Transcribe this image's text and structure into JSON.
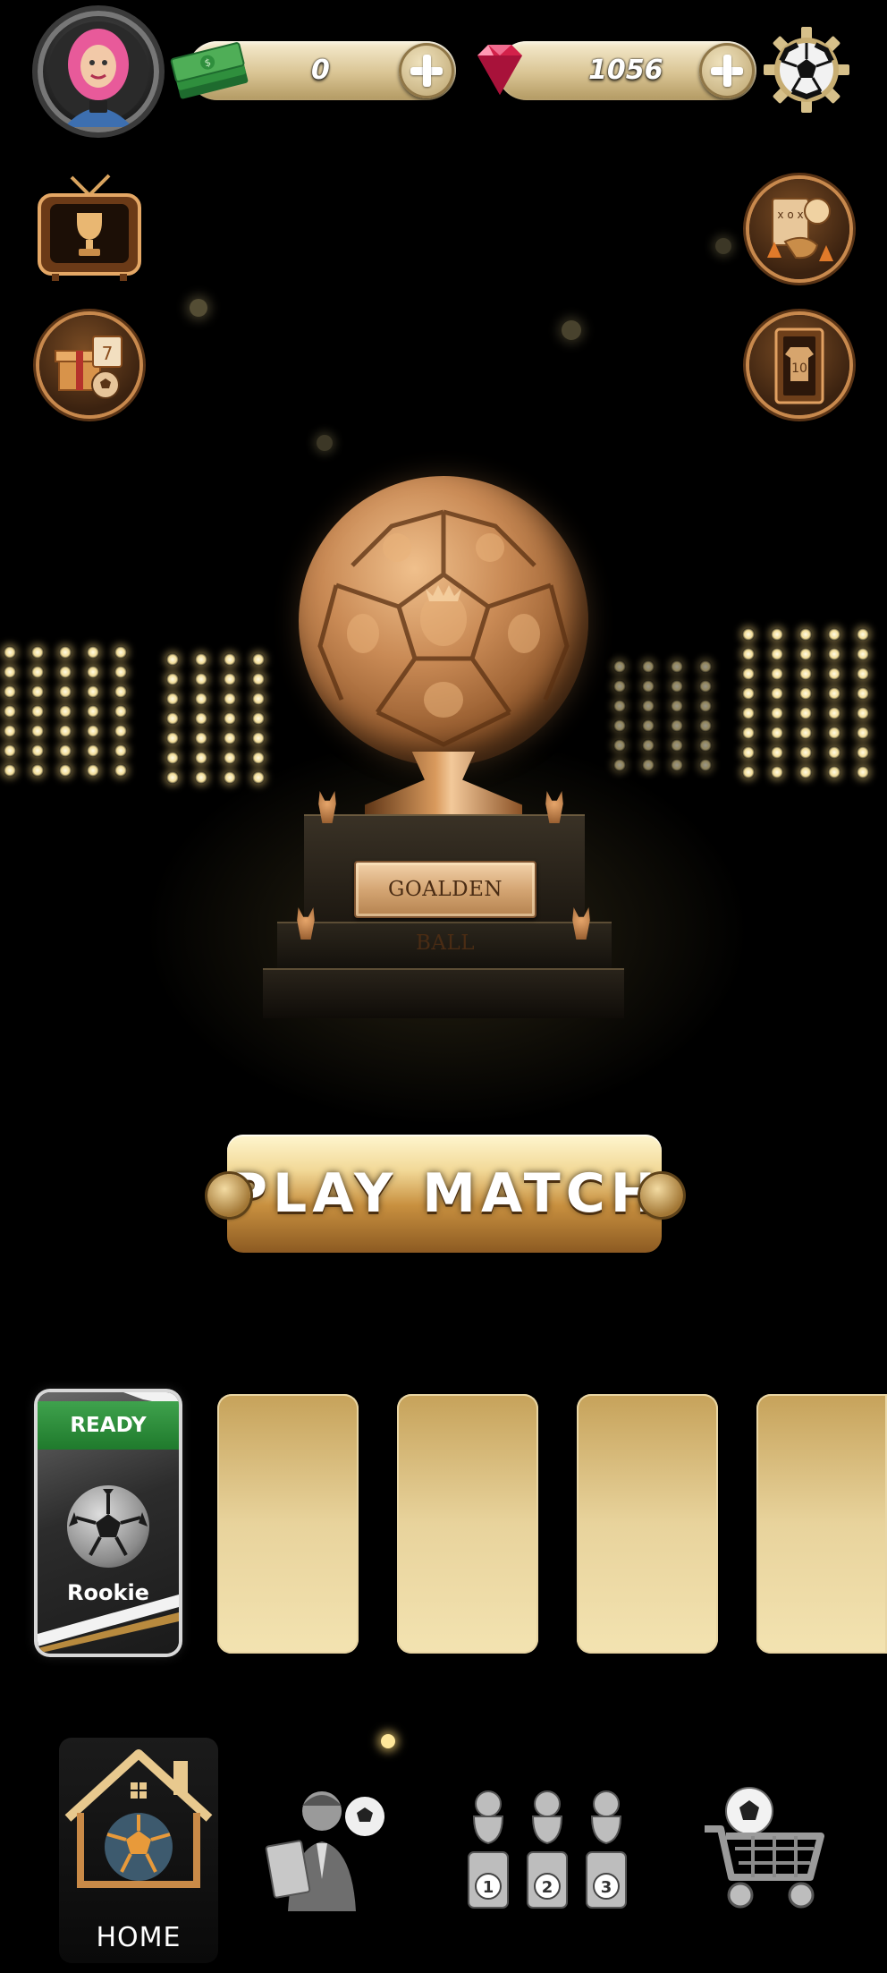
{
  "header": {
    "avatar": "avatar",
    "cash_amount": "0",
    "gems_amount": "1056",
    "icons": {
      "cash": "cash-stack-icon",
      "gem": "red-diamond-icon",
      "settings": "soccer-ball-gear-icon"
    }
  },
  "side_buttons": {
    "left": [
      "tv-trophy-icon",
      "daily-gift-icon"
    ],
    "right": [
      "tactics-whistle-icon",
      "locker-icon"
    ]
  },
  "trophy": {
    "plaque_text": "GOALDEN BALL"
  },
  "play_button": {
    "label": "PLAY MATCH"
  },
  "slots": {
    "ready_card": {
      "status": "READY",
      "tier": "Rookie"
    },
    "empty_count": 4
  },
  "nav": {
    "home_label": "HOME",
    "items": [
      "home-icon",
      "manager-icon",
      "trophies-ranking-icon",
      "shop-cart-icon"
    ]
  },
  "colors": {
    "gold": "#d9c493",
    "bronze": "#c8894d",
    "ready_green": "#2f8f3d",
    "background": "#000000"
  }
}
